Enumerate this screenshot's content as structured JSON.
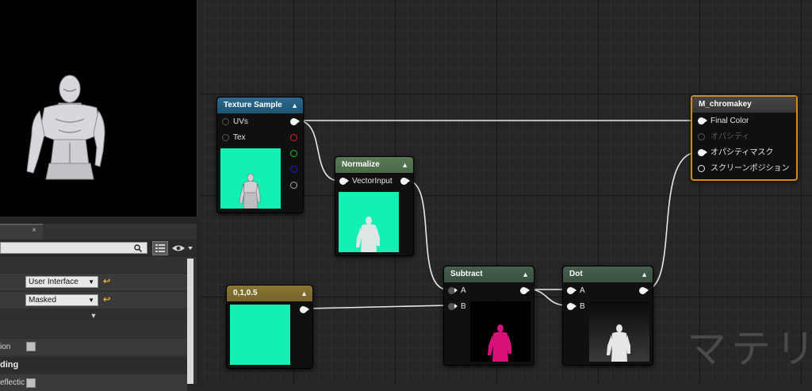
{
  "details_panel": {
    "tab_close": "×",
    "rows": [
      {
        "dropdown": "User Interface"
      },
      {
        "dropdown": "Masked"
      }
    ],
    "expand_arrow": "▼",
    "checkbox_row_label": "ion",
    "section_label": "ding",
    "last_row_label": "eflectic"
  },
  "graph": {
    "nodes": {
      "texture_sample": {
        "title": "Texture Sample",
        "pins": [
          "UVs",
          "Tex"
        ]
      },
      "normalize": {
        "title": "Normalize",
        "pin": "VectorInput"
      },
      "constant": {
        "title": "0,1,0.5",
        "color": "#12f0b4"
      },
      "subtract": {
        "title": "Subtract",
        "pin_a": "A",
        "pin_b": "B"
      },
      "dot": {
        "title": "Dot",
        "pin_a": "A",
        "pin_b": "B"
      },
      "material": {
        "title": "M_chromakey",
        "pins": [
          "Final Color",
          "オパシティ",
          "オパシティマスク",
          "スクリーンポジション"
        ]
      }
    },
    "watermark": "マテリ"
  },
  "colors": {
    "graph_bg": "#262626",
    "texture_header": "#1f5472",
    "normalize_header": "#4a6a48",
    "constant_header": "#75642a",
    "math_header": "#3a4f40",
    "material_border": "#d18a1e",
    "chroma_green": "#12f0b4",
    "magenta": "#d8117a"
  },
  "icons": [
    "search-icon",
    "grid-view-icon",
    "eye-icon",
    "collapse-arrow-icon",
    "reset-arrow-icon"
  ]
}
